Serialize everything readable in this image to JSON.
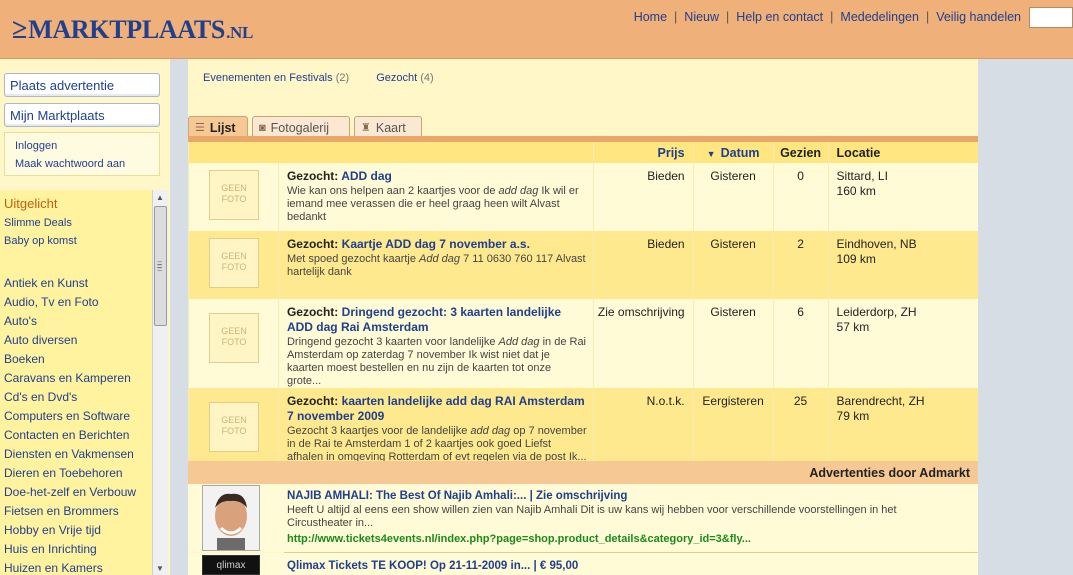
{
  "header": {
    "logo": {
      "mark": "≥",
      "name": "MARKTPLAATS",
      "tld": ".NL"
    },
    "nav": [
      "Home",
      "Nieuw",
      "Help en contact",
      "Mededelingen",
      "Veilig handelen"
    ],
    "search_placeholder": ""
  },
  "sidebar": {
    "buttons": [
      "Plaats advertentie",
      "Mijn Marktplaats"
    ],
    "login_links": [
      "Inloggen",
      "Maak wachtwoord aan"
    ],
    "featured_title": "Uitgelicht",
    "featured_items": [
      "Slimme Deals",
      "Baby op komst"
    ],
    "categories": [
      "Antiek en Kunst",
      "Audio, Tv en Foto",
      "Auto's",
      "Auto diversen",
      "Boeken",
      "Caravans en Kamperen",
      "Cd's en Dvd's",
      "Computers en Software",
      "Contacten en Berichten",
      "Diensten en Vakmensen",
      "Dieren en Toebehoren",
      "Doe-het-zelf en Verbouw",
      "Fietsen en Brommers",
      "Hobby en Vrije tijd",
      "Huis en Inrichting",
      "Huizen en Kamers"
    ]
  },
  "breadcrumbs": [
    {
      "label": "Evenementen en Festivals",
      "count": "(2)"
    },
    {
      "label": "Gezocht",
      "count": "(4)"
    }
  ],
  "tabs": [
    {
      "label": "Lijst",
      "icon": "list-icon",
      "active": true
    },
    {
      "label": "Fotogalerij",
      "icon": "camera-icon",
      "active": false
    },
    {
      "label": "Kaart",
      "icon": "map-icon",
      "active": false
    }
  ],
  "table": {
    "headers": {
      "prijs": "Prijs",
      "datum": "Datum",
      "gezien": "Gezien",
      "locatie": "Locatie"
    },
    "sort_indicator": "▼",
    "no_photo": "GEEN FOTO",
    "rows": [
      {
        "prefix": "Gezocht:",
        "title": "ADD dag",
        "snippet_html": "Wie kan ons helpen aan 2 kaartjes voor de <i>add dag</i> Ik wil er iemand mee verassen die er heel graag heen wilt Alvast bedankt",
        "prijs": "Bieden",
        "datum": "Gisteren",
        "gezien": "0",
        "plaats": "Sittard, LI",
        "afstand": "160 km"
      },
      {
        "prefix": "Gezocht:",
        "title": "Kaartje ADD dag 7 november a.s.",
        "snippet_html": "Met spoed gezocht kaartje <i>Add dag</i> 7 11 0630 760 117 Alvast hartelijk dank",
        "prijs": "Bieden",
        "datum": "Gisteren",
        "gezien": "2",
        "plaats": "Eindhoven, NB",
        "afstand": "109 km"
      },
      {
        "prefix": "Gezocht:",
        "title": "Dringend gezocht: 3 kaarten landelijke ADD dag Rai Amsterdam",
        "snippet_html": "Dringend gezocht 3 kaarten voor landelijke <i>Add dag</i> in de Rai Amsterdam op zaterdag 7 november Ik wist niet dat je kaarten moest bestellen en nu zijn de kaarten tot onze grote...",
        "prijs": "Zie omschrijving",
        "datum": "Gisteren",
        "gezien": "6",
        "plaats": "Leiderdorp, ZH",
        "afstand": "57 km"
      },
      {
        "prefix": "Gezocht:",
        "title": "kaarten landelijke add dag RAI Amsterdam 7 november 2009",
        "snippet_html": "Gezocht 3 kaartjes voor de landelijke <i>add dag</i> op 7 november in de Rai te Amsterdam 1 of 2 kaartjes ook goed Liefst afhalen in omgeving Rotterdam of evt regelen via de post Ik...",
        "prijs": "N.o.t.k.",
        "datum": "Eergisteren",
        "gezien": "25",
        "plaats": "Barendrecht, ZH",
        "afstand": "79 km"
      }
    ]
  },
  "admarkt": {
    "label": "Advertenties door Admarkt",
    "ads": [
      {
        "title": "NAJIB AMHALI: The Best Of Najib Amhali:... | Zie omschrijving",
        "snippet": "Heeft U altijd al eens een show willen zien van Najib Amhali Dit is uw kans wij hebben voor verschillende voorstellingen in het Circustheater in...",
        "url": "http://www.tickets4events.nl/index.php?page=shop.product_details&category_id=3&fly..."
      },
      {
        "title": "Qlimax Tickets TE KOOP! Op 21-11-2009 in... | € 95,00",
        "thumb_text": "qlimax"
      }
    ]
  }
}
